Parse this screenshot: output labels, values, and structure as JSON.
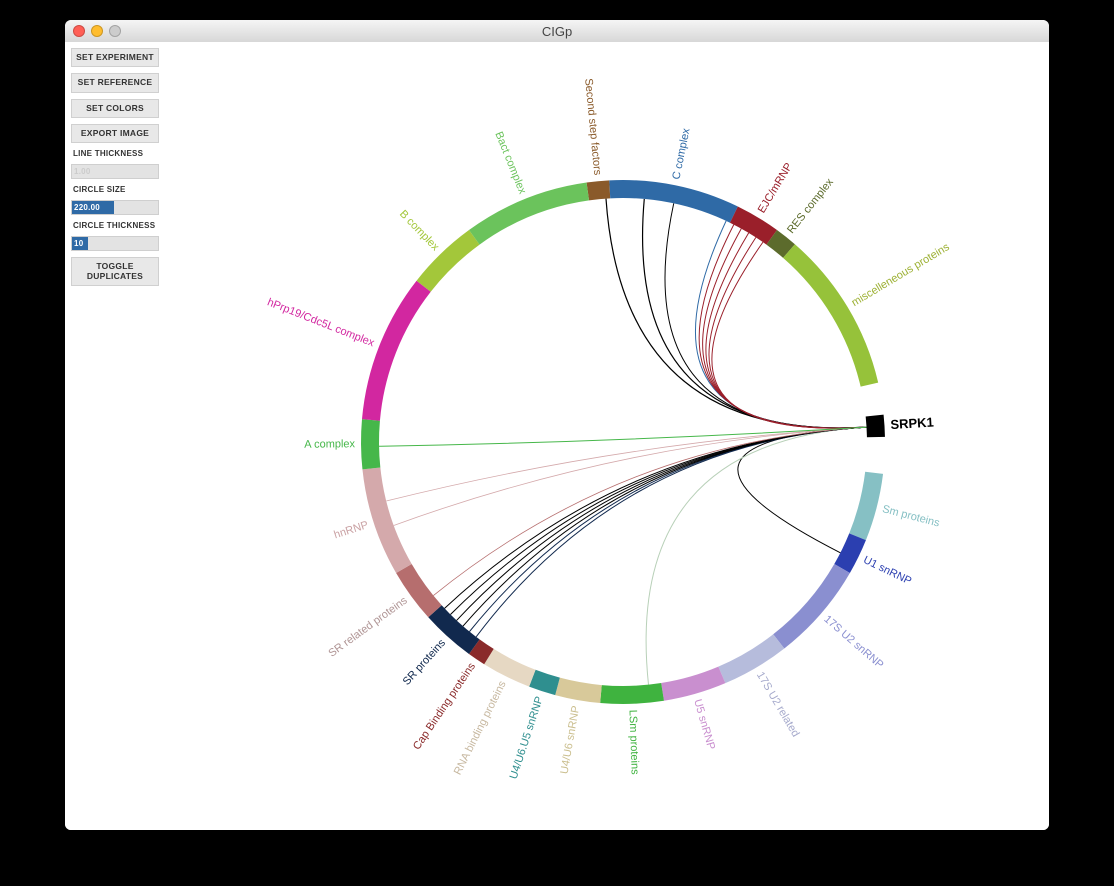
{
  "window": {
    "title": "CIGp"
  },
  "sidebar": {
    "buttons": {
      "set_experiment": "SET EXPERIMENT",
      "set_reference": "SET REFERENCE",
      "set_colors": "SET COLORS",
      "export_image": "EXPORT IMAGE",
      "toggle_duplicates": "TOGGLE\nDUPLICATES"
    },
    "fields": {
      "line_thickness": {
        "label": "LINE THICKNESS",
        "value": "1.00"
      },
      "circle_size": {
        "label": "CIRCLE SIZE",
        "value": "220.00"
      },
      "circle_thickness": {
        "label": "CIRCLE THICKNESS",
        "value": "10"
      }
    }
  },
  "chart_data": {
    "type": "chord-lite",
    "center_target": "SRPK1",
    "ring_thickness": 18,
    "radius": 262,
    "segments": [
      {
        "name": "Second step factors",
        "start": -98,
        "end": -93,
        "color": "#8a5a2a",
        "label_color": "#8a5a2a"
      },
      {
        "name": "C complex",
        "start": -93,
        "end": -64,
        "color": "#2f6aa6",
        "label_color": "#2f6aa6"
      },
      {
        "name": "EJC/mRNP",
        "start": -64,
        "end": -54,
        "color": "#9a1f2a",
        "label_color": "#9a1f2a"
      },
      {
        "name": "RES complex",
        "start": -54,
        "end": -49,
        "color": "#5c6b2c",
        "label_color": "#5c6b2c"
      },
      {
        "name": "miscelleneous proteins",
        "start": -49,
        "end": -13,
        "color": "#96c23a",
        "label_color": "#9db134"
      },
      {
        "name": "(gap1)",
        "start": -13,
        "end": -6,
        "color": "#ffffff",
        "nolabel": true
      },
      {
        "name": "SRPK1",
        "start": -6,
        "end": -1,
        "color": "#000000",
        "label_color": "#000000",
        "is_target": true
      },
      {
        "name": "(gap2)",
        "start": -1,
        "end": 7,
        "color": "#ffffff",
        "nolabel": true
      },
      {
        "name": "Sm proteins",
        "start": 7,
        "end": 22,
        "color": "#86c0c4",
        "label_color": "#86c0c4"
      },
      {
        "name": "U1 snRNP",
        "start": 22,
        "end": 30,
        "color": "#2b3fb0",
        "label_color": "#2b3fb0"
      },
      {
        "name": "17S U2 snRNP",
        "start": 30,
        "end": 52,
        "color": "#8a8fd0",
        "label_color": "#8a8fd0"
      },
      {
        "name": "17S U2 related",
        "start": 52,
        "end": 67,
        "color": "#b6bcdc",
        "label_color": "#a6aacc"
      },
      {
        "name": "U5 snRNP",
        "start": 67,
        "end": 81,
        "color": "#c98fcf",
        "label_color": "#c98fcf"
      },
      {
        "name": "LSm proteins",
        "start": 81,
        "end": 95,
        "color": "#3fb33f",
        "label_color": "#3fb33f"
      },
      {
        "name": "U4/U6 snRNP",
        "start": 95,
        "end": 105,
        "color": "#d8c99a",
        "label_color": "#cbbf8f"
      },
      {
        "name": "U4/U6.U5 snRNP",
        "start": 105,
        "end": 111,
        "color": "#2f8f8f",
        "label_color": "#2f8f8f"
      },
      {
        "name": "RNA binding proteins",
        "start": 111,
        "end": 122,
        "color": "#e6d8c3",
        "label_color": "#c7b8a0"
      },
      {
        "name": "Cap Binding proteins",
        "start": 122,
        "end": 126,
        "color": "#8a2a2a",
        "label_color": "#8a2a2a"
      },
      {
        "name": "SR proteins",
        "start": 126,
        "end": 138,
        "color": "#11294e",
        "label_color": "#11294e"
      },
      {
        "name": "SR related proteins",
        "start": 138,
        "end": 150,
        "color": "#b66e6e",
        "label_color": "#b09595"
      },
      {
        "name": "hnRNP",
        "start": 150,
        "end": 174,
        "color": "#d4a9ab",
        "label_color": "#caa2a4"
      },
      {
        "name": "A complex",
        "start": 174,
        "end": 185,
        "color": "#46b74a",
        "label_color": "#46b74a"
      },
      {
        "name": "hPrp19/Cdc5L complex",
        "start": 185,
        "end": 218,
        "color": "#d227a0",
        "label_color": "#d227a0"
      },
      {
        "name": "B complex",
        "start": 218,
        "end": 234,
        "color": "#a3c73a",
        "label_color": "#a3c73a"
      },
      {
        "name": "Bact complex",
        "start": 234,
        "end": 262,
        "color": "#6bc35c",
        "label_color": "#6bc35c"
      }
    ],
    "chords": [
      {
        "source_angle": -94,
        "color": "#000000",
        "w": 1.2
      },
      {
        "source_angle": -85,
        "color": "#000000",
        "w": 1.2
      },
      {
        "source_angle": -78,
        "color": "#000000",
        "w": 1.0
      },
      {
        "source_angle": -65,
        "color": "#2f6aa6",
        "w": 1.0
      },
      {
        "source_angle": -63,
        "color": "#9a1f2a",
        "w": 1.0
      },
      {
        "source_angle": -61,
        "color": "#9a1f2a",
        "w": 1.0
      },
      {
        "source_angle": -59,
        "color": "#9a1f2a",
        "w": 1.0
      },
      {
        "source_angle": -57,
        "color": "#9a1f2a",
        "w": 1.0
      },
      {
        "source_angle": -55,
        "color": "#9a1f2a",
        "w": 1.0
      },
      {
        "source_angle": 27,
        "color": "#000000",
        "w": 1.0
      },
      {
        "source_angle": 84,
        "color": "#b8d0b8",
        "w": 1.0
      },
      {
        "source_angle": 127,
        "color": "#11294e",
        "w": 1.0
      },
      {
        "source_angle": 129,
        "color": "#11294e",
        "w": 1.0
      },
      {
        "source_angle": 131,
        "color": "#000000",
        "w": 1.0
      },
      {
        "source_angle": 133,
        "color": "#000000",
        "w": 1.0
      },
      {
        "source_angle": 135,
        "color": "#000000",
        "w": 1.0
      },
      {
        "source_angle": 137,
        "color": "#000000",
        "w": 1.0
      },
      {
        "source_angle": 141,
        "color": "#b66e6e",
        "w": 0.8
      },
      {
        "source_angle": 160,
        "color": "#d4a9ab",
        "w": 0.8
      },
      {
        "source_angle": 166,
        "color": "#d4a9ab",
        "w": 0.8
      },
      {
        "source_angle": 179,
        "color": "#46b74a",
        "w": 1.0
      }
    ]
  }
}
